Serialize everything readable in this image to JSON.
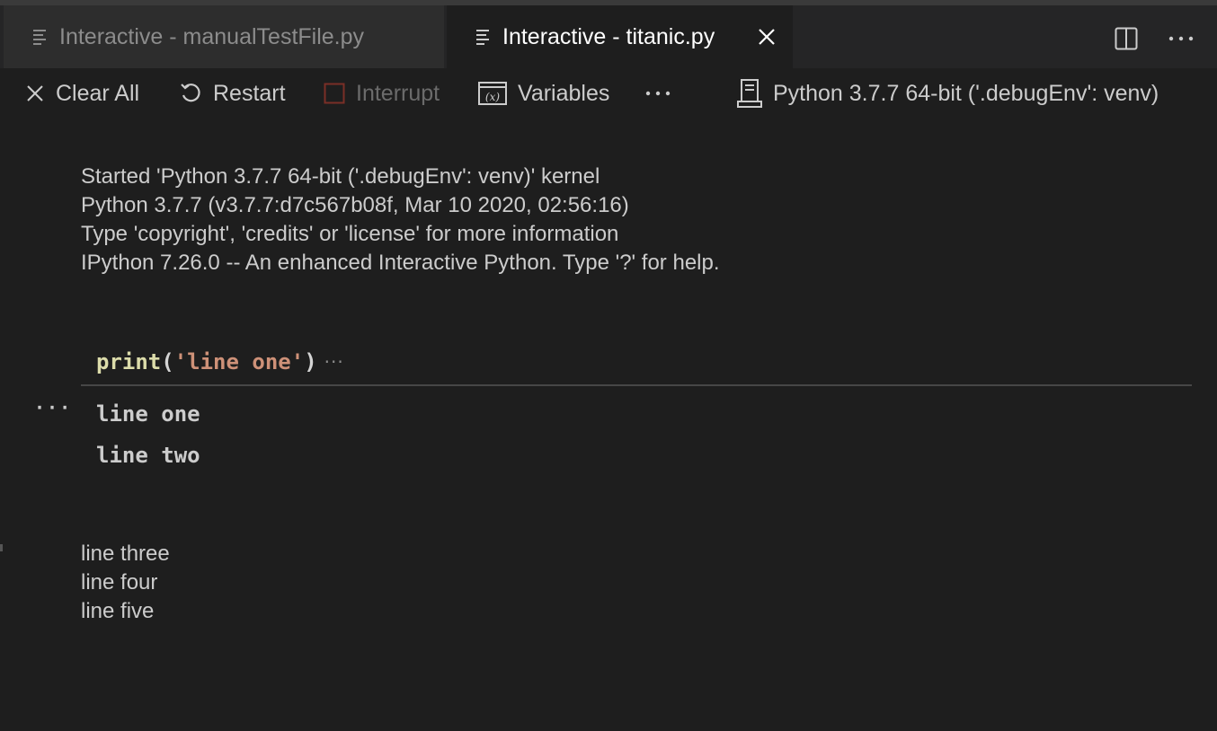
{
  "tabs": [
    {
      "label": "Interactive - manualTestFile.py",
      "active": false
    },
    {
      "label": "Interactive - titanic.py",
      "active": true
    }
  ],
  "editor_actions": {
    "split": "split-editor-icon",
    "more": "more-actions-icon"
  },
  "toolbar": {
    "clear_all": "Clear All",
    "restart": "Restart",
    "interrupt": "Interrupt",
    "variables": "Variables",
    "kernel": "Python 3.7.7 64-bit ('.debugEnv': venv)"
  },
  "kernel_info": [
    "Started 'Python 3.7.7 64-bit ('.debugEnv': venv)' kernel",
    "Python 3.7.7 (v3.7.7:d7c567b08f, Mar 10 2020, 02:56:16)",
    "Type 'copyright', 'credits' or 'license' for more information",
    "IPython 7.26.0 -- An enhanced Interactive Python. Type '?' for help."
  ],
  "cell": {
    "code_fn": "print",
    "code_open": "(",
    "code_str": "'line one'",
    "code_close": ")",
    "collapsed_indicator": "···",
    "output_more": "···",
    "outputs": [
      "line one",
      "line two"
    ]
  },
  "trailing_output": [
    "line three",
    "line four",
    "line five"
  ],
  "colors": {
    "background": "#1e1e1e",
    "tabbar": "#252526",
    "function": "#dcdcaa",
    "string": "#ce9178",
    "interrupt_square": "#a1260d"
  }
}
